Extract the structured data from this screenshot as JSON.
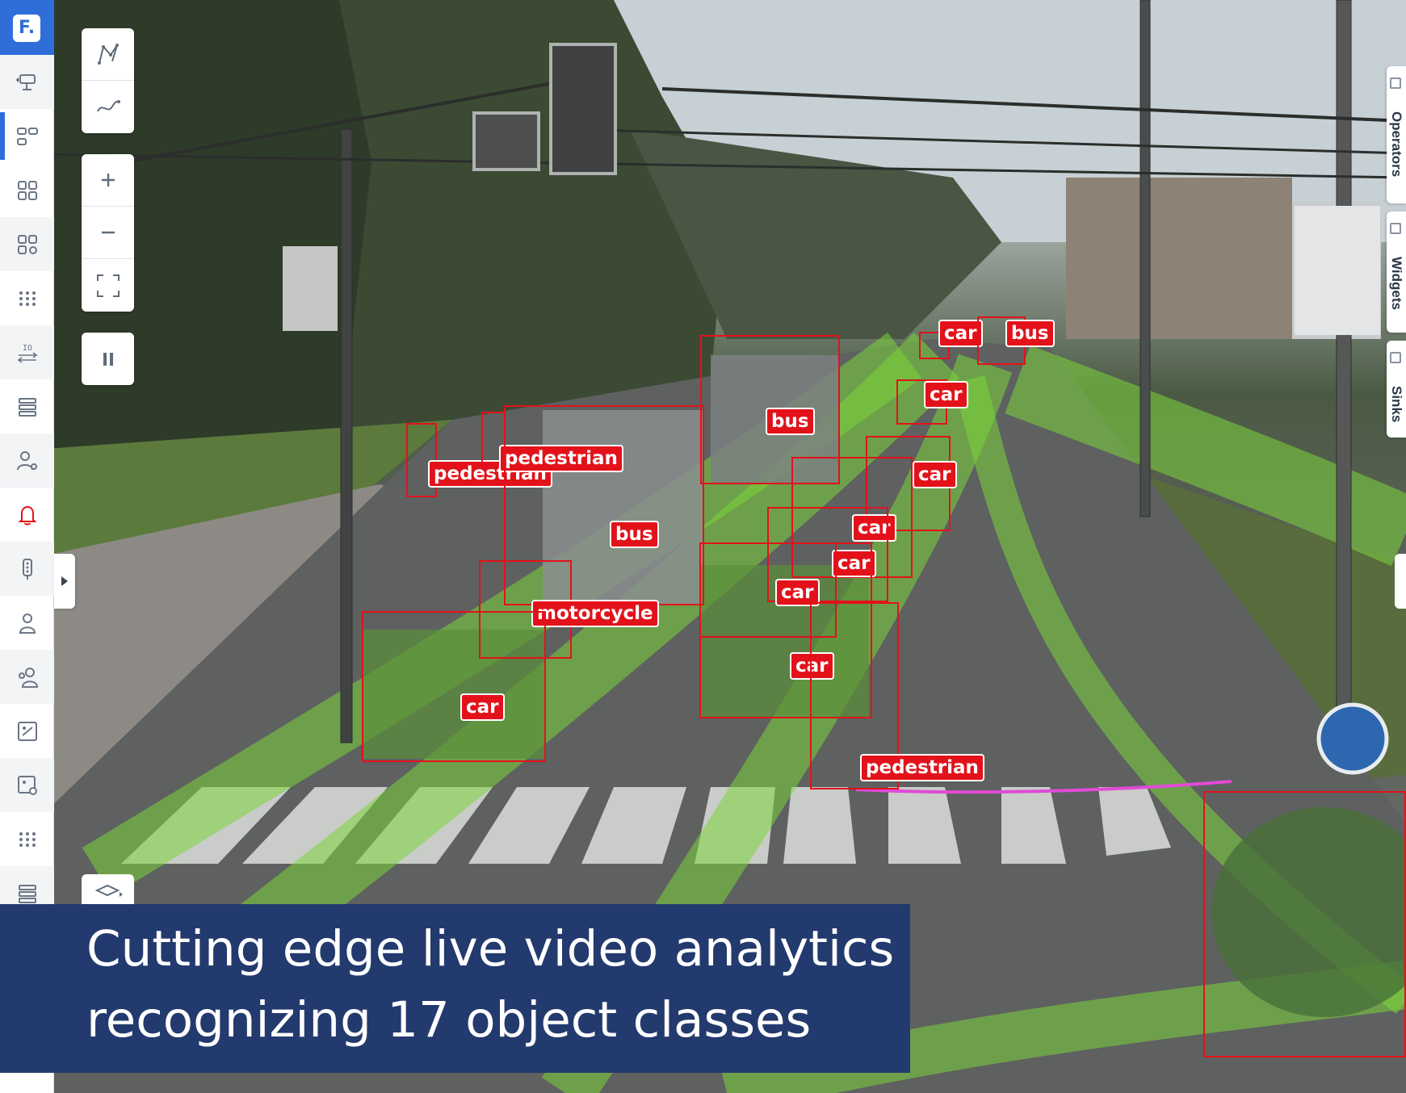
{
  "app": {
    "logo_text": "F."
  },
  "sidebar": {
    "items": [
      {
        "icon": "camera-settings-icon"
      },
      {
        "icon": "scenario-graph-icon"
      },
      {
        "icon": "grid-icon"
      },
      {
        "icon": "grid-settings-icon"
      },
      {
        "icon": "dots-grid-icon"
      },
      {
        "icon": "io-transfer-icon",
        "label": "IO"
      },
      {
        "icon": "list-icon"
      },
      {
        "icon": "user-settings-icon"
      },
      {
        "icon": "bell-icon",
        "color": "#e3121a"
      },
      {
        "icon": "traffic-light-icon"
      },
      {
        "icon": "person-icon"
      },
      {
        "icon": "people-icon"
      },
      {
        "icon": "map-icon"
      },
      {
        "icon": "map-settings-icon"
      },
      {
        "icon": "dots-grid-icon"
      },
      {
        "icon": "list-icon"
      }
    ]
  },
  "tools": {
    "draw": [
      "polygon-draw-icon",
      "line-draw-icon"
    ],
    "zoom": [
      "zoom-in-icon",
      "zoom-out-icon",
      "fullscreen-icon"
    ],
    "playback": "pause-icon",
    "layers": "layers-icon"
  },
  "right_tabs": [
    "Operators",
    "Widgets",
    "Sinks"
  ],
  "detections": [
    {
      "label": "car"
    },
    {
      "label": "bus"
    },
    {
      "label": "car"
    },
    {
      "label": "bus"
    },
    {
      "label": "car"
    },
    {
      "label": "pedestrian"
    },
    {
      "label": "pedestrian"
    },
    {
      "label": "car"
    },
    {
      "label": "bus"
    },
    {
      "label": "car"
    },
    {
      "label": "car"
    },
    {
      "label": "motorcycle"
    },
    {
      "label": "car"
    },
    {
      "label": "car"
    },
    {
      "label": "pedestrian"
    }
  ],
  "caption": {
    "line1": "Cutting edge live video analytics",
    "line2": "recognizing 17 object classes"
  },
  "colors": {
    "accent": "#2f6ed8",
    "detection": "#e3121a",
    "trajectory": "#7bd63a",
    "banner": "#233a6e"
  }
}
